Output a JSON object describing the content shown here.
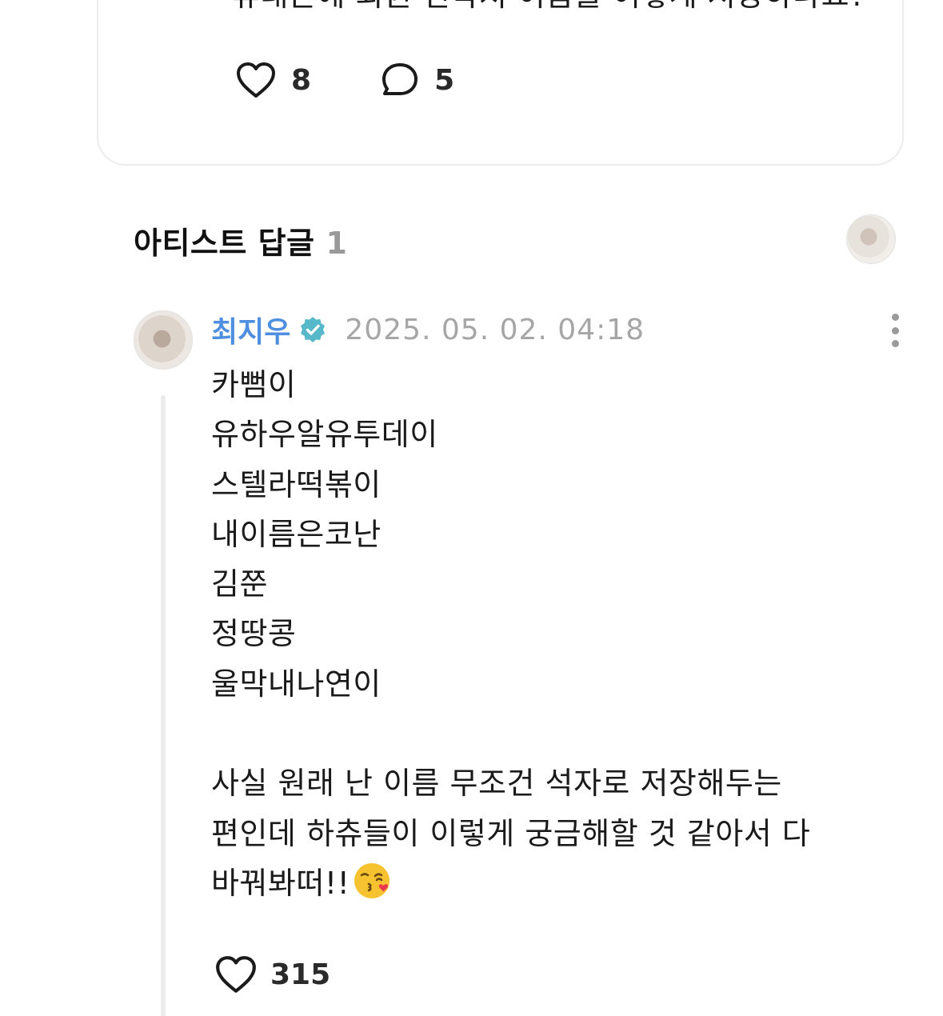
{
  "post": {
    "question": "휴대폰에 회원 연락처 이름을 어떻게 저장하나요?",
    "like_count": "8",
    "comment_count": "5"
  },
  "section": {
    "title": "아티스트 답글",
    "count": "1"
  },
  "comment": {
    "author": "최지우",
    "verified": true,
    "timestamp": "2025. 05. 02. 04:18",
    "lines": [
      "카뻠이",
      "유하우알유투데이",
      "스텔라떡볶이",
      "내이름은코난",
      "김쭌",
      "정땅콩",
      "울막내나연이",
      "",
      "사실 원래 난 이름 무조건 석자로 저장해두는",
      "편인데 하츄들이 이렇게 궁금해할 것 같아서 다",
      "바꿔봐떠!!"
    ],
    "like_count": "315"
  },
  "colors": {
    "author_blue": "#4f8fe0",
    "verified_teal": "#56b8c9",
    "muted_gray": "#a6a6a6",
    "card_border": "#ececec"
  },
  "icons": [
    "heart-outline-icon",
    "comment-bubble-icon",
    "verified-badge-icon",
    "more-vertical-icon",
    "kiss-heart-emoji-icon"
  ]
}
